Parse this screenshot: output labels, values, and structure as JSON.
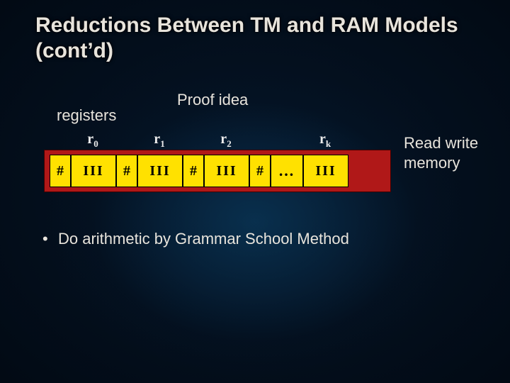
{
  "title": "Reductions Between TM and RAM Models (cont’d)",
  "proof_idea": "Proof idea",
  "registers_label": "registers",
  "memory_label": "Read write memory",
  "bullet_text": "Do arithmetic by Grammar School Method",
  "tape": {
    "register_names": [
      "r",
      "r",
      "r",
      "r"
    ],
    "register_subs": [
      "0",
      "1",
      "2",
      "k"
    ],
    "hash": "#",
    "bars": "III",
    "dots": "…"
  }
}
